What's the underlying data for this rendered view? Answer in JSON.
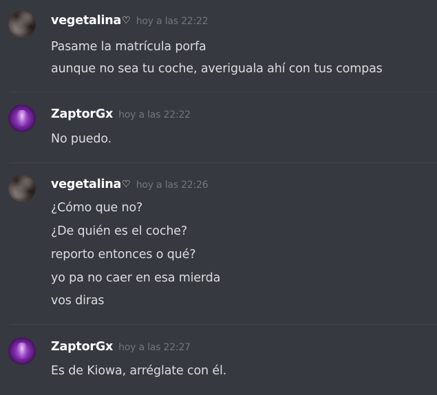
{
  "messages": [
    {
      "username": "vegetalina",
      "heart": "♡",
      "timestamp": "hoy a las 22:22",
      "avatar": "vegetalina-avatar",
      "lines": [
        "Pasame la matrícula porfa",
        "aunque no sea tu coche, averiguala ahí con tus compas"
      ]
    },
    {
      "username": "ZaptorGx",
      "timestamp": "hoy a las 22:22",
      "avatar": "zaptorgx-avatar",
      "lines": [
        "No puedo."
      ]
    },
    {
      "username": "vegetalina",
      "heart": "♡",
      "timestamp": "hoy a las 22:26",
      "avatar": "vegetalina-avatar",
      "lines": [
        "¿Cómo que no?",
        "¿De quién es el coche?",
        "reporto entonces o qué?",
        "yo pa no caer en esa mierda",
        "vos diras"
      ]
    },
    {
      "username": "ZaptorGx",
      "timestamp": "hoy a las 22:27",
      "avatar": "zaptorgx-avatar",
      "lines": [
        "Es de Kiowa, arréglate con él."
      ]
    }
  ],
  "colors": {
    "background": "#36393f",
    "username": "#ffffff",
    "timestamp": "#72767d",
    "text": "#dcddde",
    "divider": "#42454b"
  }
}
